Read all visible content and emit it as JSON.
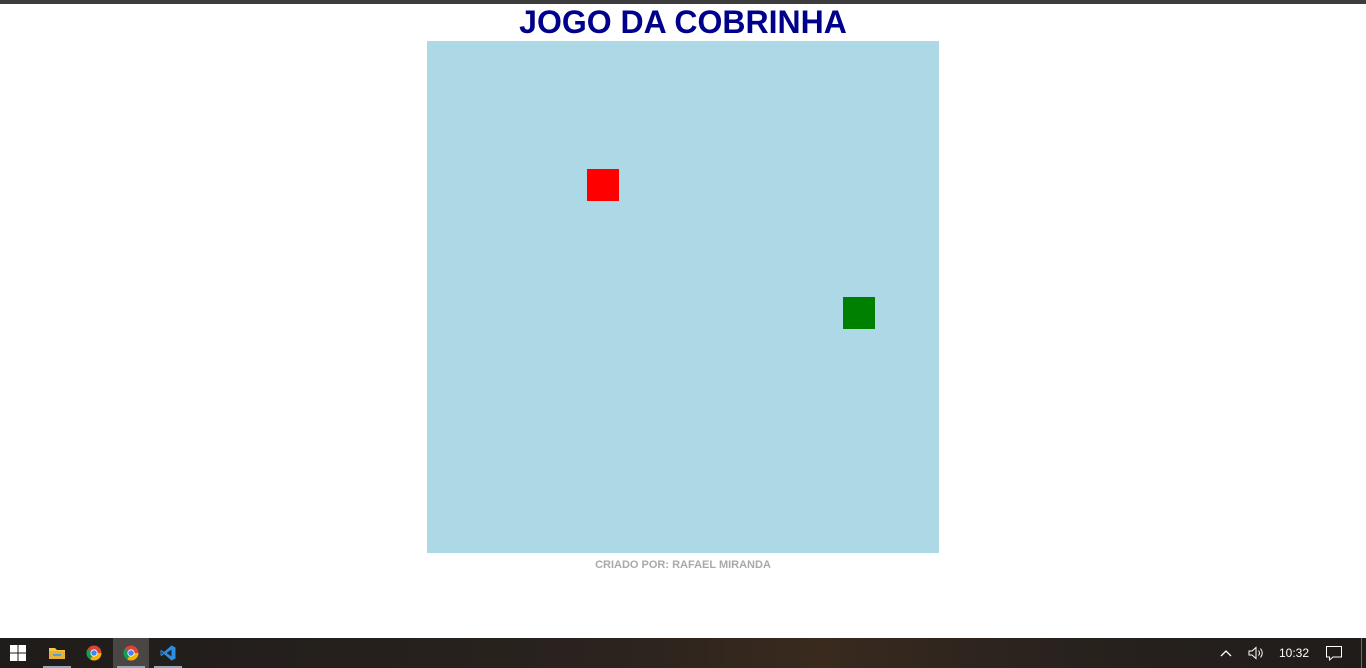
{
  "game": {
    "title": "JOGO DA COBRINHA",
    "credit": "CRIADO POR: RAFAEL MIRANDA",
    "grid_columns": 16,
    "grid_rows": 16,
    "food": {
      "col": 5,
      "row": 4
    },
    "snake": [
      {
        "col": 13,
        "row": 8
      }
    ],
    "colors": {
      "title": "#00008b",
      "board": "#add8e6",
      "food": "#ff0000",
      "snake": "#008000",
      "credit": "#a9a9a9"
    }
  },
  "taskbar": {
    "apps": [
      {
        "name": "start-icon"
      },
      {
        "name": "file-explorer-icon"
      },
      {
        "name": "chrome-icon"
      },
      {
        "name": "chrome-icon",
        "active": true
      },
      {
        "name": "vscode-icon"
      }
    ],
    "tray": {
      "chevron": "chevron-up-icon",
      "volume": "volume-icon",
      "clock": "10:32",
      "notifications": "notification-icon"
    }
  }
}
